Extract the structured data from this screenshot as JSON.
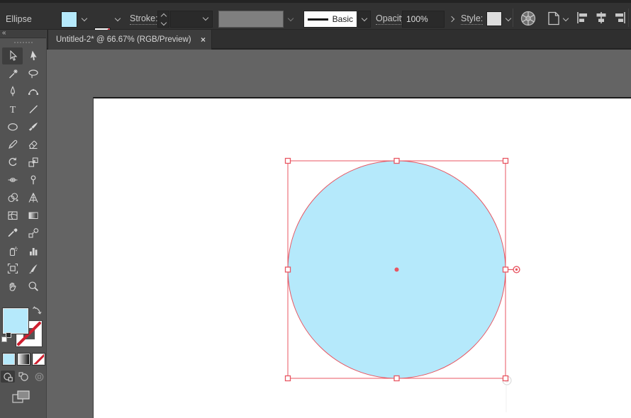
{
  "control_bar": {
    "context_label": "Ellipse",
    "stroke_label": "Stroke:",
    "brush_definition": "Basic",
    "opacity_label": "Opacity:",
    "opacity_value": "100%",
    "style_label": "Style:"
  },
  "tab": {
    "title": "Untitled-2* @ 66.67% (RGB/Preview)",
    "close_glyph": "×"
  },
  "toolbar": {
    "collapse_glyph": "«",
    "type_glyph": "T",
    "selected_tool": "Selection",
    "tools": [
      "Selection",
      "Direct Selection",
      "Magic Wand",
      "Lasso",
      "Pen",
      "Curvature",
      "Type",
      "Line Segment",
      "Ellipse",
      "Paintbrush",
      "Pencil",
      "Eraser",
      "Rotate",
      "Scale",
      "Width",
      "Puppet Warp",
      "Shape Builder",
      "Perspective Grid",
      "Mesh",
      "Gradient",
      "Eyedropper",
      "Blend",
      "Symbol Sprayer",
      "Column Graph",
      "Artboard",
      "Slice",
      "Hand",
      "Zoom"
    ]
  },
  "selection": {
    "shape_type": "ellipse",
    "fill_active": true,
    "stroke_active": false
  },
  "colors": {
    "fill": "#b5e9fb",
    "selection": "#e85662",
    "none_slash": "#cf2030",
    "bar": "#323232",
    "panel": "#535353",
    "canvas": "#646464",
    "artboard": "#ffffff"
  }
}
